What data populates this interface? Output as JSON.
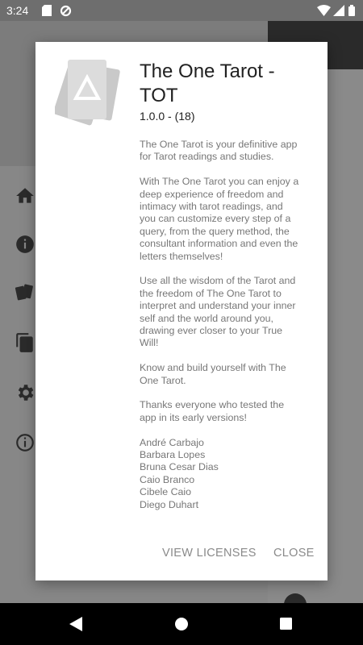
{
  "status_bar": {
    "time": "3:24",
    "icons": [
      "sd-card-icon",
      "data-saver-icon",
      "wifi-icon",
      "signal-icon",
      "battery-icon"
    ]
  },
  "drawer": {
    "items": [
      {
        "icon": "home-icon"
      },
      {
        "icon": "info-icon"
      },
      {
        "icon": "cards-icon"
      },
      {
        "icon": "copy-icon"
      },
      {
        "icon": "settings-icon"
      },
      {
        "icon": "info-outline-icon"
      }
    ]
  },
  "dialog": {
    "title": "The One Tarot - TOT",
    "version": "1.0.0 - (18)",
    "paragraphs": [
      "The One Tarot is your definitive app for Tarot readings and studies.",
      "With The One Tarot you can enjoy a deep experience of freedom and intimacy with tarot readings, and you can customize every step of a query, from the query method, the consultant information and even the letters themselves!",
      "Use all the wisdom of the Tarot and the freedom of The One Tarot to interpret and understand your inner self and the world around you, drawing ever closer to your True Will!",
      "Know and build yourself with The One Tarot.",
      "Thanks everyone who tested the app in its early versions!"
    ],
    "contributors": [
      "André Carbajo",
      "Barbara Lopes",
      "Bruna Cesar Dias",
      "Caio Branco",
      "Cibele Caio",
      "Diego Duhart"
    ],
    "actions": {
      "view_licenses": "VIEW LICENSES",
      "close": "CLOSE"
    }
  },
  "colors": {
    "scrim": "#7a7a7a",
    "dialog_bg": "#ffffff",
    "body_text": "#777777",
    "action_text": "#8a8a8a"
  }
}
